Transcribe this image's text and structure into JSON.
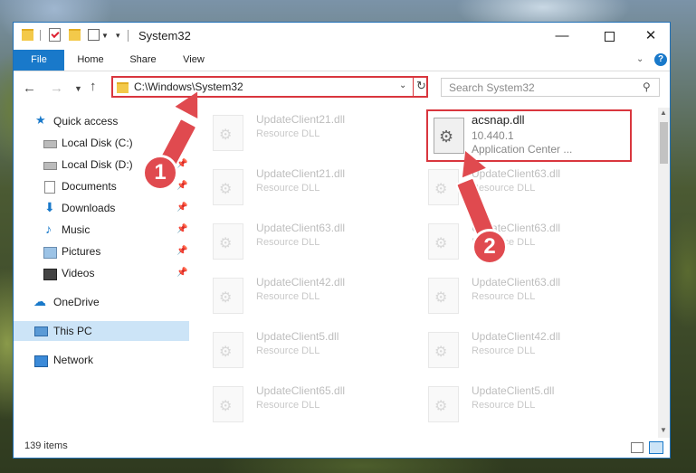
{
  "window": {
    "title": "System32",
    "controls": {
      "minimize": "—",
      "maximize": "",
      "close": "✕"
    }
  },
  "ribbon": {
    "tabs": [
      "File",
      "Home",
      "Share",
      "View"
    ],
    "help": "?"
  },
  "address": {
    "path": "C:\\Windows\\System32",
    "search_placeholder": "Search System32"
  },
  "nav_pane": {
    "items": [
      {
        "label": "Quick access",
        "icon": "star-icon"
      },
      {
        "label": "Local Disk (C:)",
        "icon": "drive-icon",
        "pinned": true
      },
      {
        "label": "Local Disk (D:)",
        "icon": "drive-icon",
        "pinned": true
      },
      {
        "label": "Documents",
        "icon": "documents-icon",
        "pinned": true
      },
      {
        "label": "Downloads",
        "icon": "download-icon",
        "pinned": true
      },
      {
        "label": "Music",
        "icon": "music-icon",
        "pinned": true
      },
      {
        "label": "Pictures",
        "icon": "pictures-icon",
        "pinned": true
      },
      {
        "label": "Videos",
        "icon": "videos-icon",
        "pinned": true
      },
      {
        "label": "OneDrive",
        "icon": "cloud-icon"
      },
      {
        "label": "This PC",
        "icon": "pc-icon",
        "selected": true
      },
      {
        "label": "Network",
        "icon": "network-icon"
      }
    ]
  },
  "files": {
    "left_column": [
      {
        "name": "UpdateClient21.dll",
        "desc": "Resource DLL"
      },
      {
        "name": "UpdateClient21.dll",
        "desc": "Resource DLL"
      },
      {
        "name": "UpdateClient63.dll",
        "desc": "Resource DLL"
      },
      {
        "name": "UpdateClient42.dll",
        "desc": "Resource DLL"
      },
      {
        "name": "UpdateClient5.dll",
        "desc": "Resource DLL"
      },
      {
        "name": "UpdateClient65.dll",
        "desc": "Resource DLL"
      }
    ],
    "right_column": [
      {
        "name": "UpdateClient63.dll",
        "desc": "Resource DLL"
      },
      {
        "name": "UpdateClient63.dll",
        "desc": "Resource DLL"
      },
      {
        "name": "UpdateClient63.dll",
        "desc": "Resource DLL"
      },
      {
        "name": "UpdateClient42.dll",
        "desc": "Resource DLL"
      },
      {
        "name": "UpdateClient5.dll",
        "desc": "Resource DLL"
      }
    ],
    "highlighted": {
      "name": "acsnap.dll",
      "version": "10.440.1",
      "desc": "Application Center ..."
    }
  },
  "status": {
    "item_count": "139 items"
  },
  "annotations": {
    "step1": "1",
    "step2": "2"
  },
  "colors": {
    "accent": "#1979ca",
    "highlight": "#d9363e",
    "annotation": "#e04a4f"
  }
}
